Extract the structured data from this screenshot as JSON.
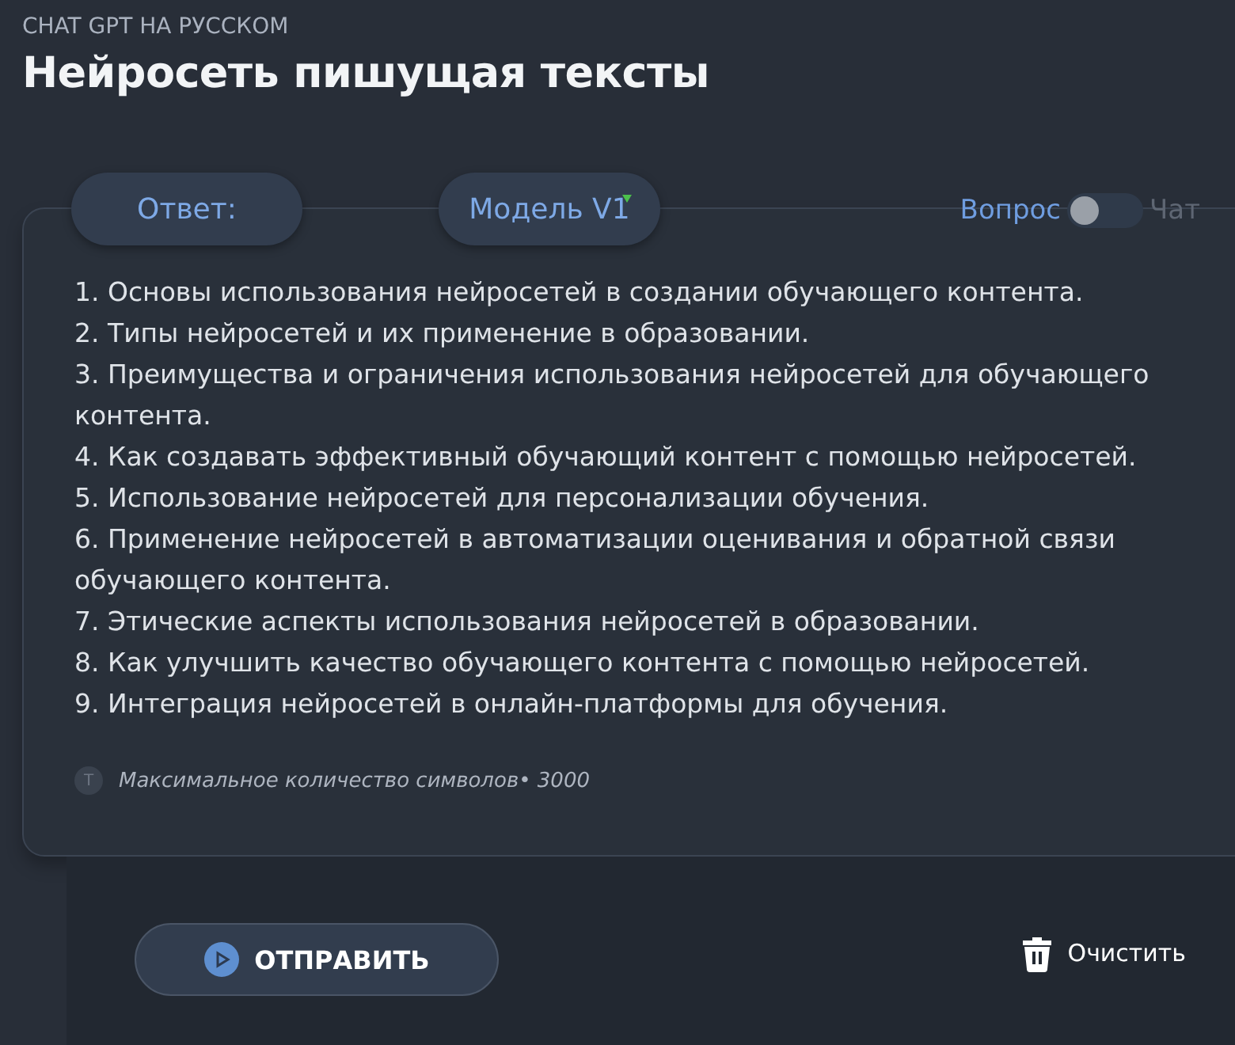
{
  "header": {
    "kicker": "CHAT GPT НА РУССКОМ",
    "title": "Нейросеть пишущая тексты"
  },
  "answer_label": "Ответ:",
  "model_select": {
    "label": "Модель V1"
  },
  "mode_switch": {
    "left_label": "Вопрос",
    "right_label": "Чат",
    "on": false
  },
  "answer_items": [
    "1. Основы использования нейросетей в создании обучающего контента.",
    "2. Типы нейросетей и их применение в образовании.",
    "3. Преимущества и ограничения использования нейросетей для обучающего контента.",
    "4. Как создавать эффективный обучающий контент с помощью нейросетей.",
    "5. Использование нейросетей для персонализации обучения.",
    "6. Применение нейросетей в автоматизации оценивания и обратной связи обучающего контента.",
    "7. Этические аспекты использования нейросетей в образовании.",
    "8. Как улучшить качество обучающего контента с помощью нейросетей.",
    "9. Интеграция нейросетей в онлайн-платформы для обучения."
  ],
  "limit_hint": {
    "icon": "T",
    "text": "Максимальное количество символов• 3000"
  },
  "send_button": "ОТПРАВИТЬ",
  "clear_button": "Очистить"
}
